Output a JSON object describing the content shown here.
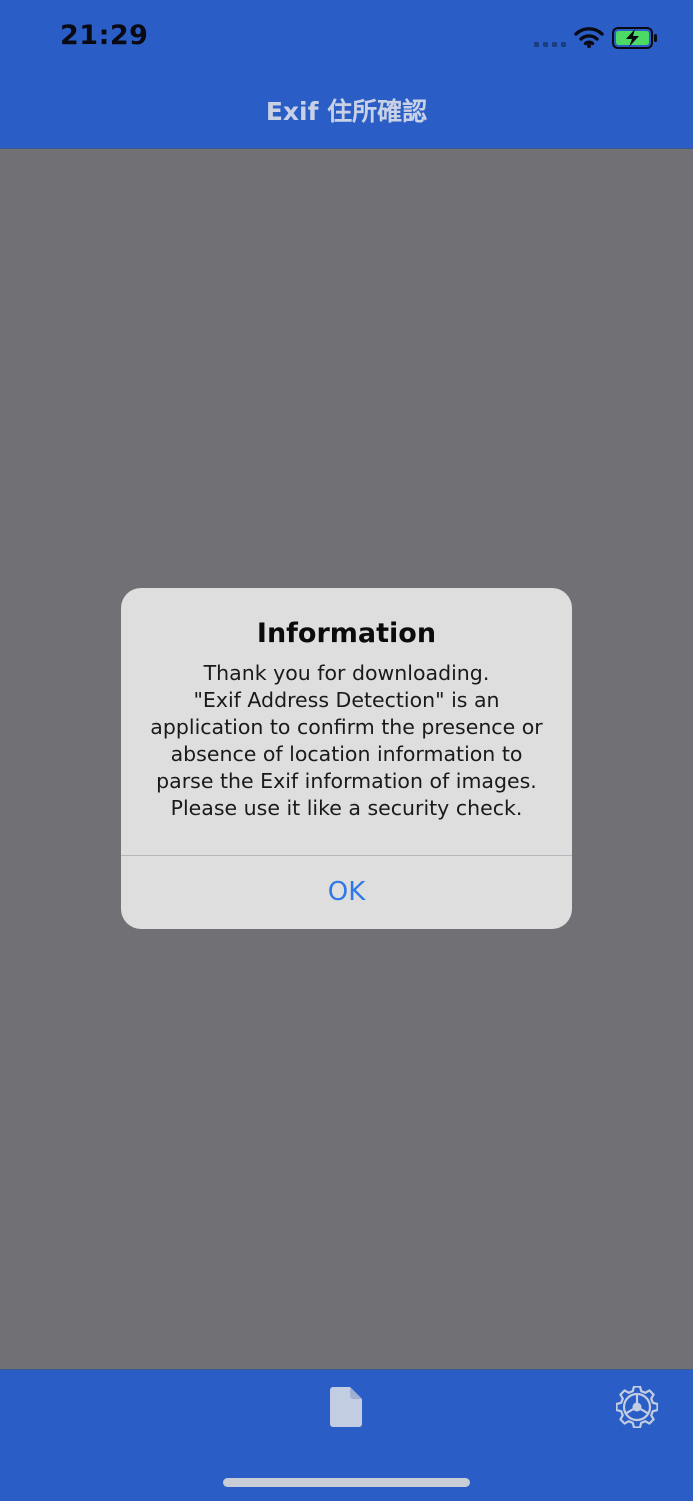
{
  "status_bar": {
    "time": "21:29",
    "icons": [
      "signal-dots-icon",
      "wifi-icon",
      "battery-charging-icon"
    ]
  },
  "nav": {
    "title": "Exif 住所確認"
  },
  "alert": {
    "title": "Information",
    "message_lines": [
      "Thank you for downloading.",
      "\"Exif Address Detection\" is an",
      "application to confirm the presence or",
      "absence of location information to",
      "parse the Exif information of images.",
      "Please use it like a security check."
    ],
    "ok_label": "OK"
  },
  "tab_bar": {
    "items": [
      {
        "icon": "document-icon"
      },
      {
        "icon": "gear-icon"
      }
    ]
  },
  "colors": {
    "bar_blue": "#2a5ec6",
    "overlay_gray": "#707075",
    "alert_bg": "#dededf",
    "link_blue": "#2f79e6",
    "battery_green": "#4cd964"
  }
}
